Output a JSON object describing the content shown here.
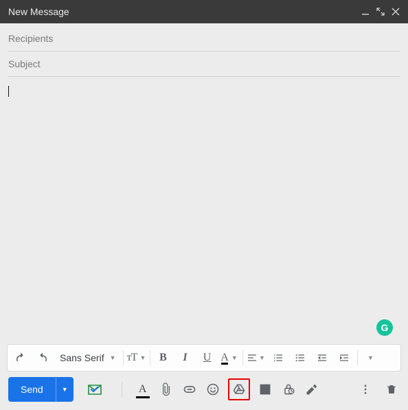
{
  "window": {
    "title": "New Message"
  },
  "fields": {
    "recipients_placeholder": "Recipients",
    "recipients_value": "",
    "subject_placeholder": "Subject",
    "subject_value": "",
    "body_value": ""
  },
  "format_toolbar": {
    "font_family": "Sans Serif",
    "size_glyph": "ᴛT",
    "bold_glyph": "B",
    "italic_glyph": "I",
    "underline_glyph": "U",
    "textcolor_glyph": "A"
  },
  "bottom_bar": {
    "send_label": "Send"
  },
  "grammarly": {
    "glyph": "G"
  }
}
